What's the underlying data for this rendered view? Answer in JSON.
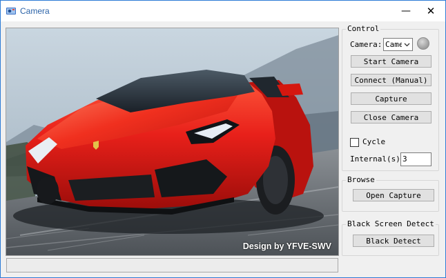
{
  "window": {
    "title": "Camera",
    "icon": "camera-app-icon",
    "minimize_symbol": "—",
    "close_symbol": "✕"
  },
  "preview": {
    "watermark": "Design by YFVE-SWV"
  },
  "status": {
    "text": ""
  },
  "control": {
    "legend": "Control",
    "camera_label": "Camera:",
    "camera_value": "Camera",
    "start_camera": "Start Camera",
    "connect_manual": "Connect (Manual)",
    "capture": "Capture",
    "close_camera": "Close Camera",
    "cycle_label": "Cycle",
    "cycle_checked": false,
    "interval_label": "Internal(s)",
    "interval_value": "3"
  },
  "browse": {
    "legend": "Browse",
    "open_capture": "Open Capture"
  },
  "black_screen": {
    "legend": "Black Screen Detect",
    "black_detect": "Black Detect"
  },
  "colors": {
    "window_border": "#2b7bd6",
    "title_text": "#2b63a8",
    "button_face": "#e1e1e1",
    "car_red": "#e8201a"
  }
}
